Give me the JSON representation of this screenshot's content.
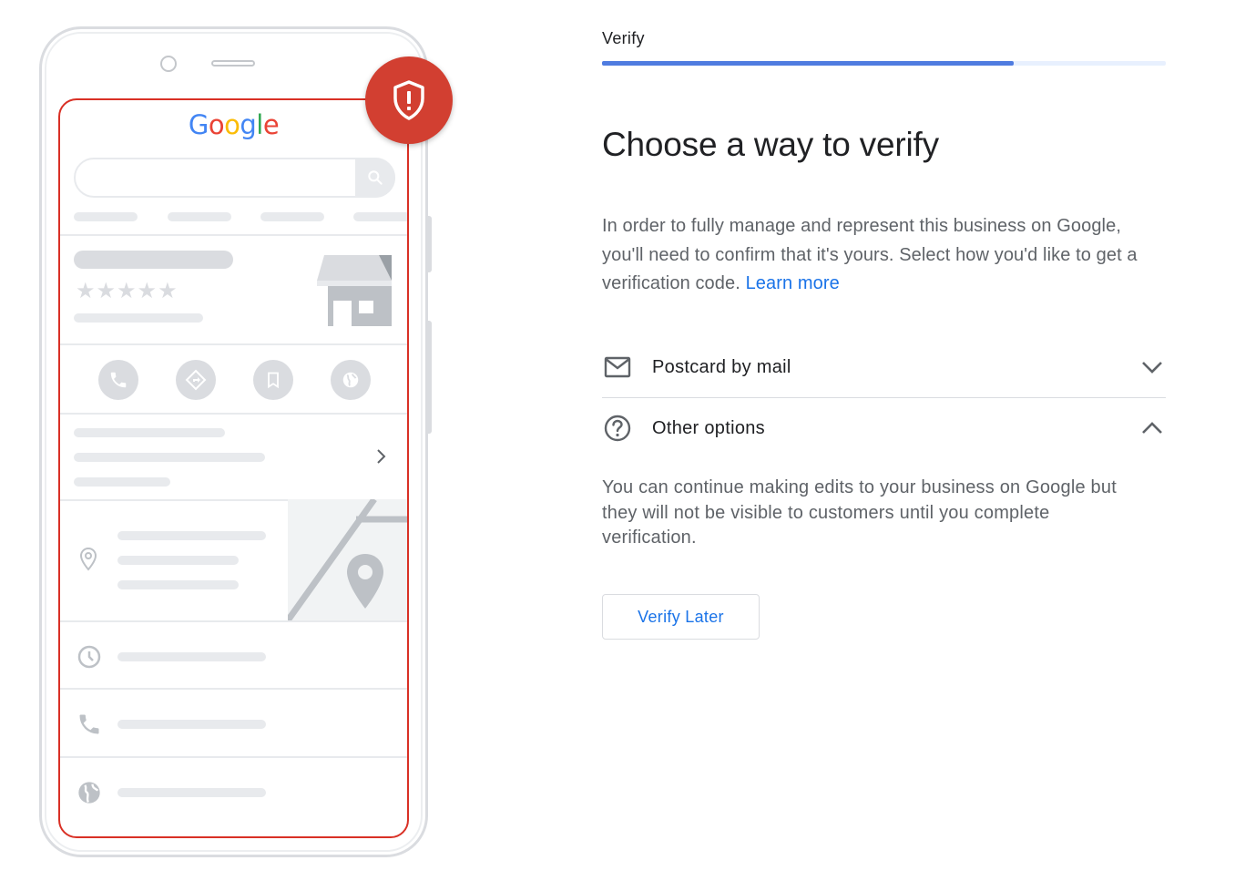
{
  "illustration": {
    "logo_letters": [
      {
        "ch": "G",
        "color": "#4285f4"
      },
      {
        "ch": "o",
        "color": "#ea4335"
      },
      {
        "ch": "o",
        "color": "#fbbc05"
      },
      {
        "ch": "g",
        "color": "#4285f4"
      },
      {
        "ch": "l",
        "color": "#34a853"
      },
      {
        "ch": "e",
        "color": "#ea4335"
      }
    ],
    "stars": "★★★★★",
    "accent_color": "#d93025"
  },
  "header": {
    "step_label": "Verify",
    "progress": 0.73
  },
  "main": {
    "heading": "Choose a way to verify",
    "intro_text": "In order to fully manage and represent this business on Google, you'll need to confirm that it's yours. Select how you'd like to get a verification code.",
    "learn_more": "Learn more",
    "options": [
      {
        "label": "Postcard by mail",
        "icon": "mail-icon",
        "expanded": false
      },
      {
        "label": "Other options",
        "icon": "help-circle-icon",
        "expanded": true
      }
    ],
    "other_options_description": "You can continue making edits to your business on Google but they will not be visible to customers until you complete verification.",
    "verify_later_label": "Verify Later"
  },
  "colors": {
    "link": "#1a73e8",
    "progress": "#4f7ce0",
    "badge": "#d23f31"
  }
}
